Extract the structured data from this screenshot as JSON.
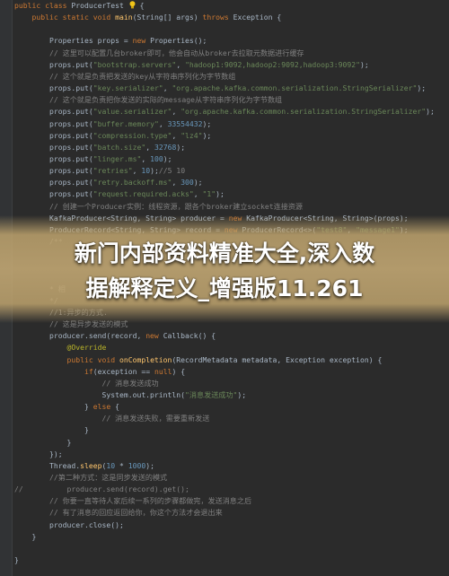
{
  "overlay": {
    "title_line1": "新门内部资料精准大全,深入数",
    "title_line2": "据解释定义_增强版11.261"
  },
  "lines": [
    [
      [
        "kw",
        "public class "
      ],
      [
        "plain",
        "ProducerTest "
      ],
      [
        "icon",
        "bulb"
      ],
      [
        "plain",
        " {"
      ]
    ],
    [
      [
        "kw",
        "    public static void "
      ],
      [
        "fn",
        "main"
      ],
      [
        "plain",
        "(String[] args) "
      ],
      [
        "kw",
        "throws "
      ],
      [
        "plain",
        "Exception {"
      ]
    ],
    [],
    [
      [
        "plain",
        "        Properties props = "
      ],
      [
        "kw",
        "new "
      ],
      [
        "plain",
        "Properties();"
      ]
    ],
    [
      [
        "cm",
        "        // 这里可以配置几台broker即可，他会自动从broker去拉取元数据进行缓存"
      ]
    ],
    [
      [
        "plain",
        "        props.put("
      ],
      [
        "str",
        "\"bootstrap.servers\""
      ],
      [
        "plain",
        ", "
      ],
      [
        "str",
        "\"hadoop1:9092,hadoop2:9092,hadoop3:9092\""
      ],
      [
        "plain",
        ");"
      ]
    ],
    [
      [
        "cm",
        "        // 这个就是负责把发送的key从字符串序列化为字节数组"
      ]
    ],
    [
      [
        "plain",
        "        props.put("
      ],
      [
        "str",
        "\"key.serializer\""
      ],
      [
        "plain",
        ", "
      ],
      [
        "str",
        "\"org.apache.kafka.common.serialization.StringSerializer\""
      ],
      [
        "plain",
        ");"
      ]
    ],
    [
      [
        "cm",
        "        // 这个就是负责把你发送的实际的message从字符串序列化为字节数组"
      ]
    ],
    [
      [
        "plain",
        "        props.put("
      ],
      [
        "str",
        "\"value.serializer\""
      ],
      [
        "plain",
        ", "
      ],
      [
        "str",
        "\"org.apache.kafka.common.serialization.StringSerializer\""
      ],
      [
        "plain",
        ");"
      ]
    ],
    [
      [
        "plain",
        "        props.put("
      ],
      [
        "str",
        "\"buffer.memory\""
      ],
      [
        "plain",
        ", "
      ],
      [
        "num",
        "33554432"
      ],
      [
        "plain",
        ");"
      ]
    ],
    [
      [
        "plain",
        "        props.put("
      ],
      [
        "str",
        "\"compression.type\""
      ],
      [
        "plain",
        ", "
      ],
      [
        "str",
        "\"lz4\""
      ],
      [
        "plain",
        ");"
      ]
    ],
    [
      [
        "plain",
        "        props.put("
      ],
      [
        "str",
        "\"batch.size\""
      ],
      [
        "plain",
        ", "
      ],
      [
        "num",
        "32768"
      ],
      [
        "plain",
        ");"
      ]
    ],
    [
      [
        "plain",
        "        props.put("
      ],
      [
        "str",
        "\"linger.ms\""
      ],
      [
        "plain",
        ", "
      ],
      [
        "num",
        "100"
      ],
      [
        "plain",
        ");"
      ]
    ],
    [
      [
        "plain",
        "        props.put("
      ],
      [
        "str",
        "\"retries\""
      ],
      [
        "plain",
        ", "
      ],
      [
        "num",
        "10"
      ],
      [
        "plain",
        ");"
      ],
      [
        "cm",
        "//5 10"
      ]
    ],
    [
      [
        "plain",
        "        props.put("
      ],
      [
        "str",
        "\"retry.backoff.ms\""
      ],
      [
        "plain",
        ", "
      ],
      [
        "num",
        "300"
      ],
      [
        "plain",
        ");"
      ]
    ],
    [
      [
        "plain",
        "        props.put("
      ],
      [
        "str",
        "\"request.required.acks\""
      ],
      [
        "plain",
        ", "
      ],
      [
        "str",
        "\"1\""
      ],
      [
        "plain",
        ");"
      ]
    ],
    [
      [
        "cm",
        "        // 创建一个Producer实例：线程资源，跟各个broker建立socket连接资源"
      ]
    ],
    [
      [
        "plain",
        "        KafkaProducer<String, String> producer = "
      ],
      [
        "kw",
        "new "
      ],
      [
        "plain",
        "KafkaProducer<String, String>(props);"
      ]
    ],
    [
      [
        "plain",
        "        ProducerRecord<String, String> record = "
      ],
      [
        "kw",
        "new "
      ],
      [
        "plain",
        "ProducerRecord<>("
      ],
      [
        "str",
        "\"test8\""
      ],
      [
        "plain",
        ", "
      ],
      [
        "str",
        "\"message1\""
      ],
      [
        "plain",
        ");"
      ]
    ],
    [
      [
        "cm",
        "        /**"
      ]
    ],
    [],
    [],
    [],
    [
      [
        "cm",
        "        * 相"
      ]
    ],
    [
      [
        "cm",
        "        */"
      ]
    ],
    [
      [
        "cm",
        "        //1:异步的方式."
      ]
    ],
    [
      [
        "cm",
        "        // 这是异步发送的模式"
      ]
    ],
    [
      [
        "plain",
        "        producer.send(record, "
      ],
      [
        "kw",
        "new "
      ],
      [
        "plain",
        "Callback() {"
      ]
    ],
    [
      [
        "ann",
        "            @Override"
      ]
    ],
    [
      [
        "kw",
        "            public void "
      ],
      [
        "fn",
        "onCompletion"
      ],
      [
        "plain",
        "(RecordMetadata metadata, Exception exception) {"
      ]
    ],
    [
      [
        "kw",
        "                if"
      ],
      [
        "plain",
        "(exception == "
      ],
      [
        "kw",
        "null"
      ],
      [
        "plain",
        ") {"
      ]
    ],
    [
      [
        "cm",
        "                    // 消息发送成功"
      ]
    ],
    [
      [
        "plain",
        "                    System.out.println("
      ],
      [
        "str",
        "\"消息发送成功\""
      ],
      [
        "plain",
        ");"
      ]
    ],
    [
      [
        "plain",
        "                } "
      ],
      [
        "kw",
        "else "
      ],
      [
        "plain",
        "{"
      ]
    ],
    [
      [
        "cm",
        "                    // 消息发送失败，需要重新发送"
      ]
    ],
    [
      [
        "plain",
        "                }"
      ]
    ],
    [
      [
        "plain",
        "            }"
      ]
    ],
    [
      [
        "plain",
        "        });"
      ]
    ],
    [
      [
        "plain",
        "        Thread."
      ],
      [
        "fn",
        "sleep"
      ],
      [
        "plain",
        "("
      ],
      [
        "num",
        "10"
      ],
      [
        "plain",
        " * "
      ],
      [
        "num",
        "1000"
      ],
      [
        "plain",
        ");"
      ]
    ],
    [
      [
        "cm",
        "        //第二种方式：这是同步发送的模式"
      ]
    ],
    [
      [
        "cm",
        "//          producer.send(record).get();"
      ]
    ],
    [
      [
        "cm",
        "        // 你要一直等待人家后续一系列的步骤都做完，发送消息之后"
      ]
    ],
    [
      [
        "cm",
        "        // 有了消息的回应返回给你，你这个方法才会退出来"
      ]
    ],
    [
      [
        "plain",
        "        producer.close();"
      ]
    ],
    [
      [
        "plain",
        "    }"
      ]
    ],
    [],
    [
      [
        "plain",
        "}"
      ]
    ]
  ]
}
